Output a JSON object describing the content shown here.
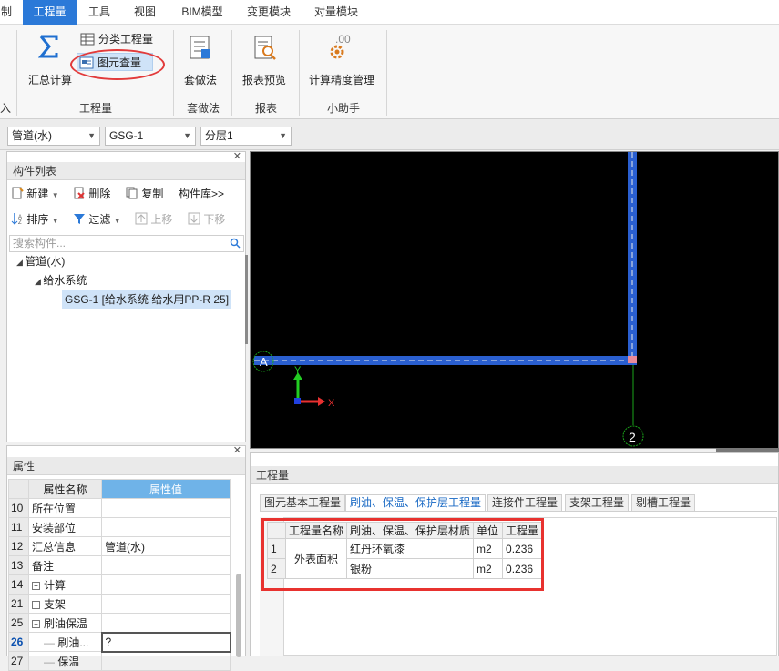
{
  "menu": {
    "items": [
      {
        "label": "制",
        "active": false
      },
      {
        "label": "工程量",
        "active": true
      },
      {
        "label": "工具",
        "active": false
      },
      {
        "label": "视图",
        "active": false
      },
      {
        "label": "BIM模型",
        "active": false
      },
      {
        "label": "变更模块",
        "active": false
      },
      {
        "label": "对量模块",
        "active": false
      }
    ]
  },
  "ribbon": {
    "left_stub_label": "入",
    "summary_calc": "汇总计算",
    "classify_qty": "分类工程量",
    "element_check": "图元查量",
    "group_qty": "工程量",
    "apply_method": "套做法",
    "group_apply": "套做法",
    "report_preview": "报表预览",
    "group_report": "报表",
    "precision_mgmt": "计算精度管理",
    "group_helper": "小助手"
  },
  "selectors": {
    "type": "管道(水)",
    "component": "GSG-1",
    "layer": "分层1"
  },
  "component_list": {
    "title": "构件列表",
    "new": "新建",
    "delete": "删除",
    "copy": "复制",
    "library": "构件库>>",
    "sort": "排序",
    "filter": "过滤",
    "move_up": "上移",
    "move_down": "下移",
    "search_placeholder": "搜索构件...",
    "tree": {
      "root": "管道(水)",
      "system": "给水系统",
      "item": "GSG-1 [给水系统 给水用PP-R 25]"
    }
  },
  "properties": {
    "title": "属性",
    "col_name": "属性名称",
    "col_value": "属性值",
    "rows": [
      {
        "num": "10",
        "name": "所在位置",
        "value": "",
        "expander": ""
      },
      {
        "num": "11",
        "name": "安装部位",
        "value": "",
        "expander": ""
      },
      {
        "num": "12",
        "name": "汇总信息",
        "value": "管道(水)",
        "expander": ""
      },
      {
        "num": "13",
        "name": "备注",
        "value": "",
        "expander": ""
      },
      {
        "num": "14",
        "name": "计算",
        "value": "",
        "expander": "+"
      },
      {
        "num": "21",
        "name": "支架",
        "value": "",
        "expander": "+"
      },
      {
        "num": "25",
        "name": "刷油保温",
        "value": "",
        "expander": "−"
      },
      {
        "num": "26",
        "name": "刷油...",
        "value": "?",
        "expander": ""
      },
      {
        "num": "27",
        "name": "保温",
        "value": "",
        "expander": ""
      }
    ]
  },
  "canvas": {
    "axis_a": "A",
    "axis_2": "2",
    "x_label": "X",
    "y_label": "Y"
  },
  "quantity": {
    "title": "工程量",
    "tabs": [
      {
        "label": "图元基本工程量",
        "active": false
      },
      {
        "label": "刷油、保温、保护层工程量",
        "active": true
      },
      {
        "label": "连接件工程量",
        "active": false
      },
      {
        "label": "支架工程量",
        "active": false
      },
      {
        "label": "剔槽工程量",
        "active": false
      }
    ],
    "headers": [
      "工程量名称",
      "刷油、保温、保护层材质",
      "单位",
      "工程量"
    ],
    "group_name": "外表面积",
    "rows": [
      {
        "num": "1",
        "material": "红丹环氧漆",
        "unit": "m2",
        "value": "0.236"
      },
      {
        "num": "2",
        "material": "银粉",
        "unit": "m2",
        "value": "0.236"
      }
    ]
  },
  "colors": {
    "accent": "#2b79d8",
    "highlight_red": "#e8322f",
    "pipe_blue": "#2a5fd0"
  }
}
